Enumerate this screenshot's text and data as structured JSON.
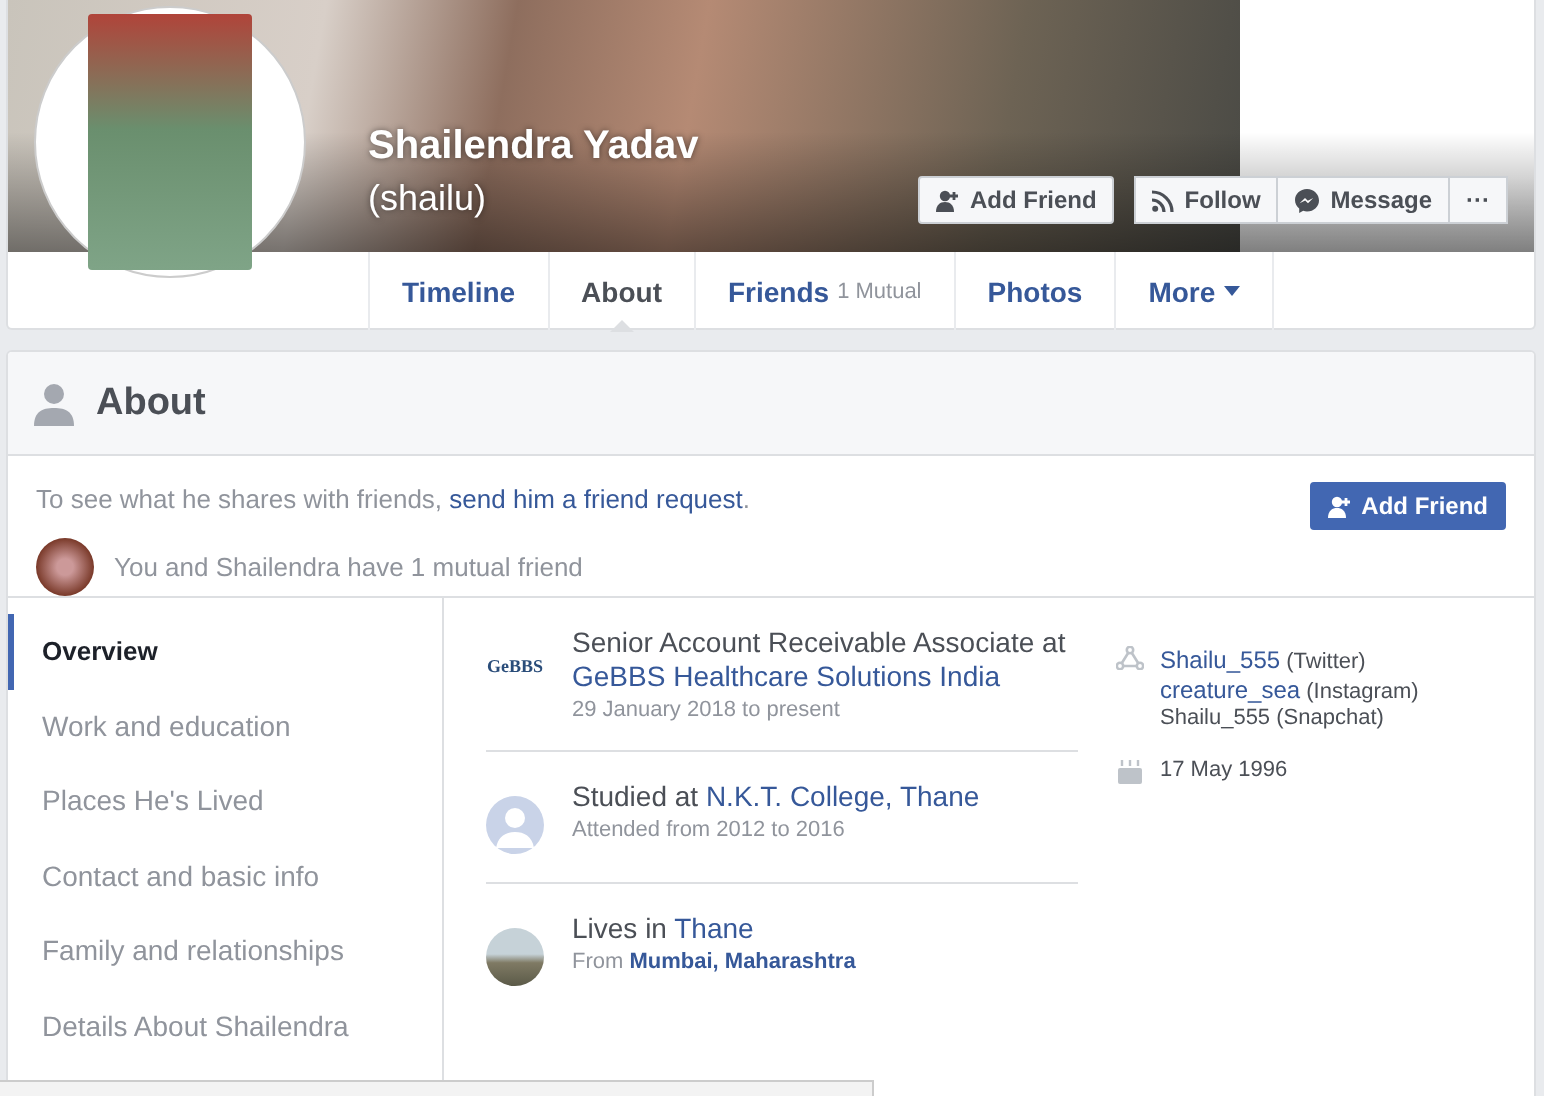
{
  "profile": {
    "name": "Shailendra Yadav",
    "nickname": "(shailu)",
    "buttons": [
      {
        "kind": "add-friend",
        "label": "Add Friend"
      },
      {
        "kind": "follow",
        "label": "Follow"
      },
      {
        "kind": "message",
        "label": "Message"
      },
      {
        "kind": "more",
        "label": "···"
      }
    ]
  },
  "tabs": [
    {
      "label": "Timeline",
      "selected": false
    },
    {
      "label": "About",
      "selected": true
    },
    {
      "label": "Friends",
      "count": "1 Mutual",
      "selected": false
    },
    {
      "label": "Photos",
      "selected": false
    },
    {
      "label": "More",
      "dropdown": true,
      "selected": false
    }
  ],
  "about": {
    "title": "About",
    "notice": "To see what he shares with friends, ",
    "notice_link": "send him a friend request",
    "notice_end": ".",
    "mutual": "You and Shailendra have 1 mutual friend",
    "add_friend": "Add Friend",
    "sections": [
      {
        "label": "Overview",
        "selected": true
      },
      {
        "label": "Work and education",
        "selected": false
      },
      {
        "label": "Places He's Lived",
        "selected": false
      },
      {
        "label": "Contact and basic info",
        "selected": false
      },
      {
        "label": "Family and relationships",
        "selected": false
      },
      {
        "label": "Details About Shailendra",
        "selected": false
      }
    ],
    "overview": [
      {
        "kind": "work",
        "logo_text": "GeBBS",
        "text": "Senior Account Receivable Associate at ",
        "link": "GeBBS Healthcare Solutions India",
        "detail": "29 January 2018 to present"
      },
      {
        "kind": "education",
        "text": "Studied at ",
        "link": "N.K.T. College, Thane",
        "detail": "Attended from 2012 to 2016"
      },
      {
        "kind": "place",
        "text": "Lives in ",
        "link": "Thane",
        "detail": "From ",
        "detail_link": "Mumbai, Maharashtra"
      }
    ],
    "contacts": [
      {
        "handle": "Shailu_555",
        "network": "(Twitter)",
        "linked": true
      },
      {
        "handle": "creature_sea",
        "network": "(Instagram)",
        "linked": true
      },
      {
        "handle": "Shailu_555",
        "network": "(Snapchat)",
        "linked": false
      }
    ],
    "birthday": "17 May 1996"
  }
}
